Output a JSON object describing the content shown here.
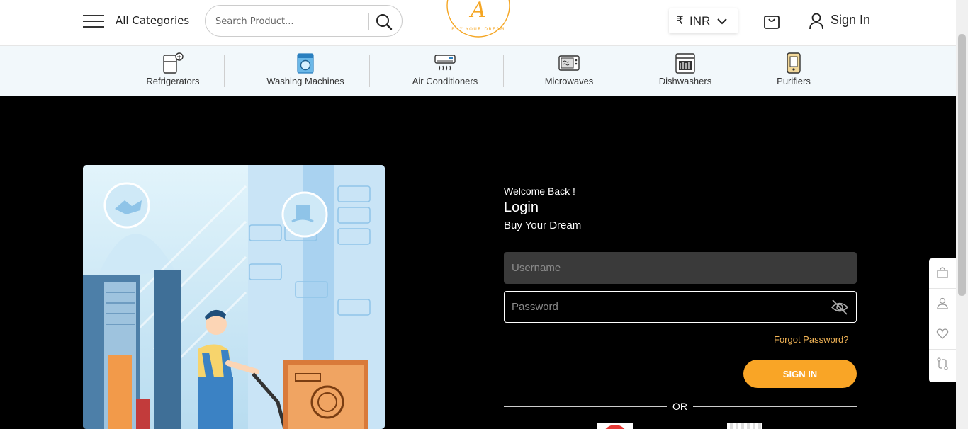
{
  "header": {
    "all_categories": "All Categories",
    "search_placeholder": "Search Product...",
    "logo_text": "A",
    "logo_tagline": "BUY YOUR DREAM",
    "currency_symbol": "₹",
    "currency_code": "INR",
    "sign_in": "Sign In"
  },
  "categories": [
    {
      "label": "Refrigerators",
      "icon": "refrigerator-icon"
    },
    {
      "label": "Washing Machines",
      "icon": "washing-machine-icon"
    },
    {
      "label": "Air Conditioners",
      "icon": "air-conditioner-icon"
    },
    {
      "label": "Microwaves",
      "icon": "microwave-icon"
    },
    {
      "label": "Dishwashers",
      "icon": "dishwasher-icon"
    },
    {
      "label": "Purifiers",
      "icon": "purifier-icon"
    }
  ],
  "login": {
    "welcome": "Welcome Back !",
    "title": "Login",
    "tagline": "Buy Your Dream",
    "username_placeholder": "Username",
    "password_placeholder": "Password",
    "forgot": "Forgot Password?",
    "submit": "SIGN IN",
    "or": "OR"
  },
  "side_tools": [
    "bag-icon",
    "user-icon",
    "heart-icon",
    "compare-icon"
  ],
  "colors": {
    "accent": "#f9a526",
    "link": "#f2b456",
    "background": "#000000",
    "category_bar": "#f2f8fb"
  }
}
